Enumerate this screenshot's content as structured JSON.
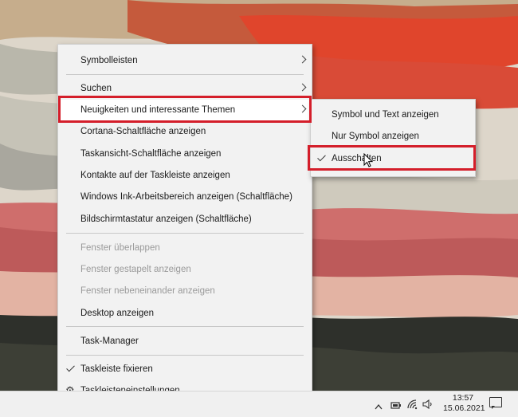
{
  "menu": {
    "items": [
      {
        "label": "Symbolleisten"
      },
      {
        "label": "Suchen"
      },
      {
        "label": "Neuigkeiten und interessante Themen"
      },
      {
        "label": "Cortana-Schaltfläche anzeigen"
      },
      {
        "label": "Taskansicht-Schaltfläche anzeigen"
      },
      {
        "label": "Kontakte auf der Taskleiste anzeigen"
      },
      {
        "label": "Windows Ink-Arbeitsbereich anzeigen (Schaltfläche)"
      },
      {
        "label": "Bildschirmtastatur anzeigen (Schaltfläche)"
      },
      {
        "label": "Fenster überlappen"
      },
      {
        "label": "Fenster gestapelt anzeigen"
      },
      {
        "label": "Fenster nebeneinander anzeigen"
      },
      {
        "label": "Desktop anzeigen"
      },
      {
        "label": "Task-Manager"
      },
      {
        "label": "Taskleiste fixieren",
        "checked": true
      },
      {
        "label": "Taskleisteneinstellungen",
        "icon": "gear-icon"
      }
    ]
  },
  "submenu": {
    "items": [
      {
        "label": "Symbol und Text anzeigen"
      },
      {
        "label": "Nur Symbol anzeigen"
      },
      {
        "label": "Ausschalten",
        "checked": true
      }
    ]
  },
  "taskbar": {
    "time": "13:57",
    "date": "15.06.2021",
    "tray_icons": [
      "chevron-up-icon",
      "battery-icon",
      "wifi-icon",
      "speaker-icon",
      "notification-icon"
    ]
  },
  "colors": {
    "highlight_outline": "#d41e2a",
    "menu_background": "#f2f2f2",
    "taskbar_background": "#f0f0f0"
  }
}
